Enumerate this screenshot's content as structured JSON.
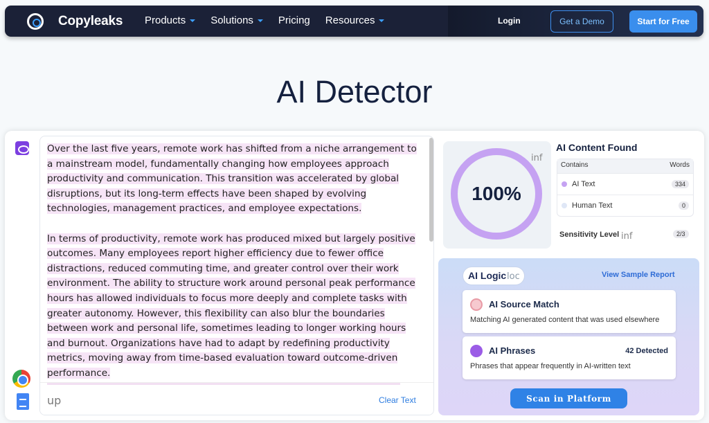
{
  "nav": {
    "logo": "Copyleaks",
    "menu": [
      "Products",
      "Solutions",
      "Pricing",
      "Resources"
    ],
    "login": "Login",
    "demo": "Get a Demo",
    "start": "Start for Free"
  },
  "page": {
    "title": "AI Detector"
  },
  "editor": {
    "para1": "Over the last five years, remote work has shifted from a niche arrangement to a mainstream model, fundamentally changing how employees approach productivity and communication. This transition was accelerated by global disruptions, but its long-term effects have been shaped by evolving technologies, management practices, and employee expectations.",
    "para2": "In terms of productivity, remote work has produced mixed but largely positive outcomes. Many employees report higher efficiency due to fewer office distractions, reduced commuting time, and greater control over their work environment. The ability to structure work around personal peak performance hours has allowed individuals to focus more deeply and complete tasks with greater autonomy. However, this flexibility can also blur the boundaries between work and personal life, sometimes leading to longer working hours and burnout. Organizations have had to adapt by redefining productivity metrics, moving away from time-based evaluation toward outcome-driven performance.",
    "input_text": "up",
    "clear": "Clear Text"
  },
  "result": {
    "score": "100%",
    "inf": "inf",
    "title": "AI Content Found",
    "col_contains": "Contains",
    "col_words": "Words",
    "rows": [
      {
        "label": "AI Text",
        "count": "334",
        "color": "#c5a2f2"
      },
      {
        "label": "Human Text",
        "count": "0",
        "color": "#dfe7f6"
      }
    ],
    "sensitivity_label": "Sensitivity Level",
    "sensitivity_inf": "inf",
    "sensitivity": "2/3"
  },
  "logic": {
    "label": "AI Logic",
    "loc": "loc",
    "view": "View Sample Report",
    "source": {
      "title": "AI Source Match",
      "desc": "Matching AI generated content that was used elsewhere"
    },
    "phrases": {
      "title": "AI Phrases",
      "count": "42 Detected",
      "desc": "Phrases that appear frequently in AI-written text"
    },
    "scan": "Scan in Platform"
  }
}
